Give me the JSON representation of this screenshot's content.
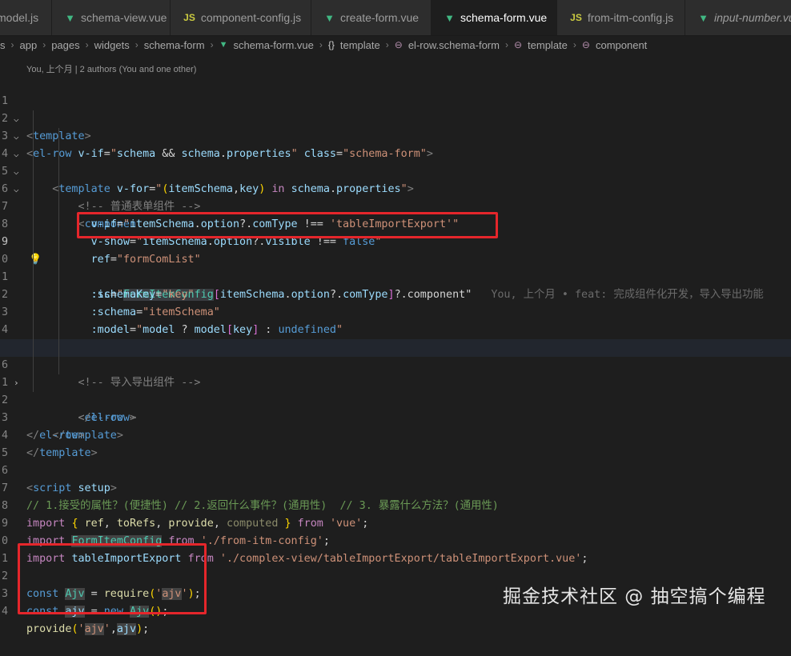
{
  "tabs": [
    {
      "icon": "vue-icon",
      "label": "model.js",
      "active": false
    },
    {
      "icon": "vue-icon",
      "label": "schema-view.vue",
      "active": false
    },
    {
      "icon": "js-icon",
      "label": "component-config.js",
      "active": false
    },
    {
      "icon": "vue-icon",
      "label": "create-form.vue",
      "active": false
    },
    {
      "icon": "vue-icon",
      "label": "schema-form.vue",
      "active": true
    },
    {
      "icon": "js-icon",
      "label": "from-itm-config.js",
      "active": false
    },
    {
      "icon": "vue-icon",
      "label": "input-number.vue",
      "active": false
    }
  ],
  "breadcrumb": [
    "s",
    "app",
    "pages",
    "widgets",
    "schema-form",
    "schema-form.vue",
    "template",
    "el-row.schema-form",
    "template",
    "component"
  ],
  "codelens": "You, 上个月 | 2 authors (You and one other)",
  "line_numbers": [
    "1",
    "2",
    "3",
    "4",
    "5",
    "6",
    "7",
    "8",
    "9",
    "0",
    "1",
    "2",
    "3",
    "4",
    "5",
    "6",
    "1",
    "2",
    "3",
    "4",
    "5",
    "6",
    "7",
    "8",
    "9",
    "0",
    "1",
    "2",
    "3",
    "4"
  ],
  "code": {
    "l4_comment": "<!-- 普通表单组件 -->",
    "l6_value": "'tableImportExport'",
    "l7_value": "false",
    "l8_value": "\"formComList\"",
    "l9_config": "FormItemConfig",
    "l9_rest": "?.component\"",
    "l10_value": "\"key\"",
    "l11_value": "\"itemSchema\"",
    "l12_value": "undefined",
    "l15_comment": "<!-- 导入导出组件 -->",
    "l16_ellipsis": "⋯",
    "l27_comment": "// 1.接受的属性？(便捷性) // 2.返回什么事件？(通用性)  // 3. 暴露什么方法？(通用性)",
    "l28_source": "'vue'",
    "l29_source": "'./from-itm-config'",
    "l30_source": "'./complex-view/tableImportExport/tableImportExport.vue'",
    "l32_arg": "'ajv'",
    "l34_arg": "'ajv'"
  },
  "blame": "You, 上个月 • feat: 完成组件化开发，导入导出功能",
  "watermark": "掘金技术社区 @ 抽空搞个编程",
  "colors": {
    "accent_box": "#e5262b",
    "vue": "#41b883",
    "js": "#cbcb41"
  }
}
